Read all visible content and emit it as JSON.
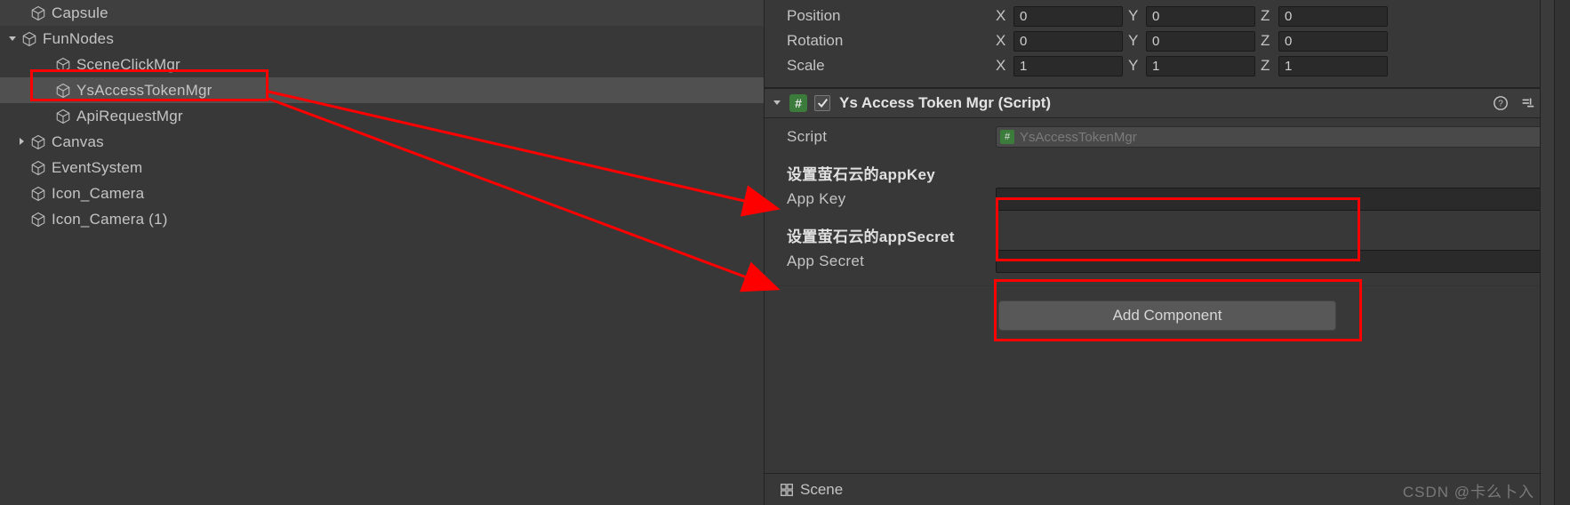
{
  "hierarchy": {
    "items": [
      {
        "label": "Capsule",
        "indent": 1,
        "fold": "none"
      },
      {
        "label": "FunNodes",
        "indent": 0,
        "fold": "open"
      },
      {
        "label": "SceneClickMgr",
        "indent": 2,
        "fold": "none"
      },
      {
        "label": "YsAccessTokenMgr",
        "indent": 2,
        "fold": "none",
        "selected": true
      },
      {
        "label": "ApiRequestMgr",
        "indent": 2,
        "fold": "none"
      },
      {
        "label": "Canvas",
        "indent": 1,
        "fold": "closed"
      },
      {
        "label": "EventSystem",
        "indent": 1,
        "fold": "none"
      },
      {
        "label": "Icon_Camera",
        "indent": 1,
        "fold": "none"
      },
      {
        "label": "Icon_Camera (1)",
        "indent": 1,
        "fold": "none"
      }
    ]
  },
  "transform": {
    "position": {
      "label": "Position",
      "x": "0",
      "y": "0",
      "z": "0"
    },
    "rotation": {
      "label": "Rotation",
      "x": "0",
      "y": "0",
      "z": "0"
    },
    "scale": {
      "label": "Scale",
      "x": "1",
      "y": "1",
      "z": "1"
    }
  },
  "axis": {
    "x": "X",
    "y": "Y",
    "z": "Z"
  },
  "component": {
    "title": "Ys Access Token Mgr (Script)",
    "script_label": "Script",
    "script_value": "YsAccessTokenMgr",
    "appkey_header": "设置萤石云的appKey",
    "appkey_label": "App Key",
    "appkey_value": "",
    "appsecret_header": "设置萤石云的appSecret",
    "appsecret_label": "App Secret",
    "appsecret_value": ""
  },
  "buttons": {
    "add_component": "Add Component"
  },
  "tabs": {
    "scene": "Scene"
  },
  "watermark": "CSDN @卡么卜入"
}
